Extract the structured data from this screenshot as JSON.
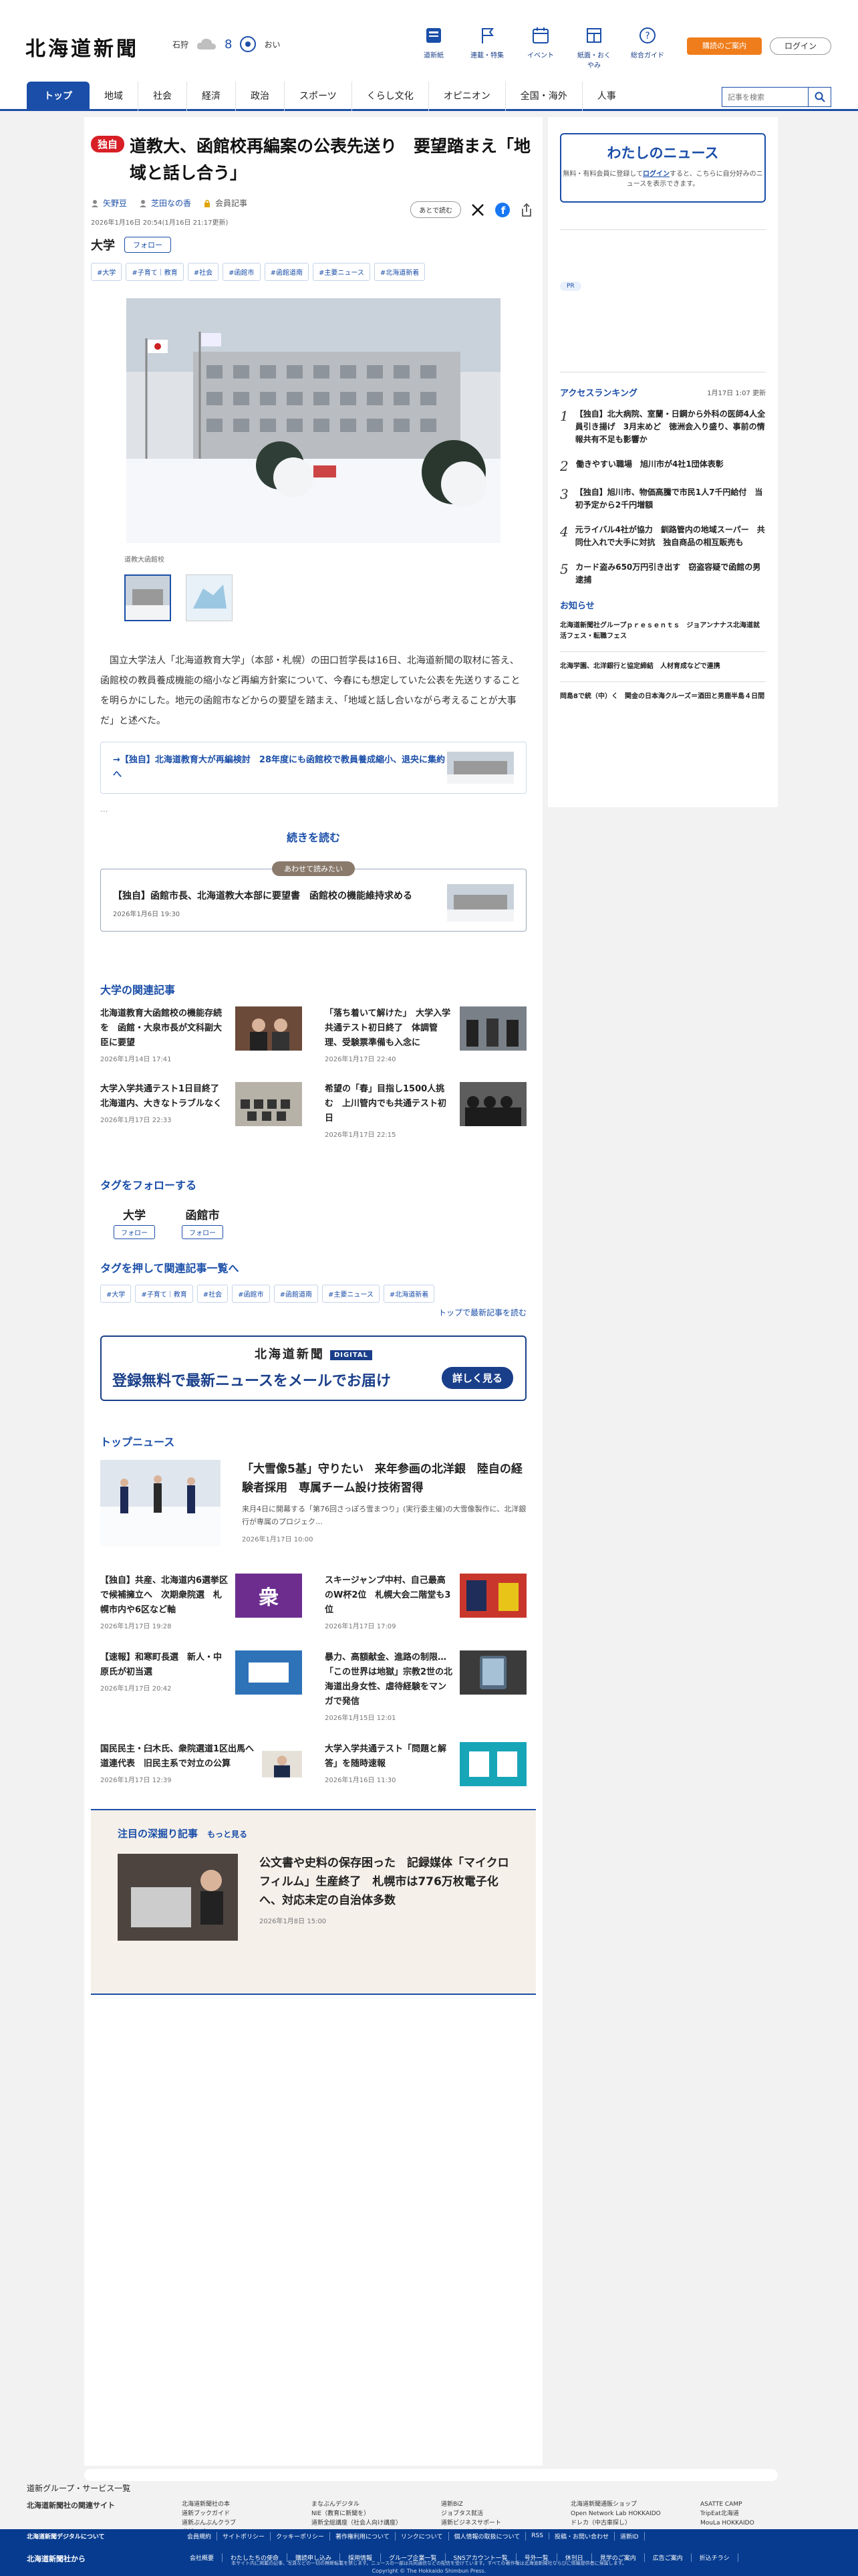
{
  "header": {
    "logo": "北海道新聞",
    "weather": {
      "city": "石狩",
      "temp": "8",
      "sub": "おい"
    },
    "nav": [
      "道新紙",
      "連載・特集",
      "イベント",
      "紙面・おくやみ",
      "総合ガイド"
    ],
    "exclusive_btn": "購読のご案内",
    "login_btn": "ログイン"
  },
  "gnav": {
    "tabs": [
      "トップ",
      "地域",
      "社会",
      "経済",
      "政治",
      "スポーツ",
      "くらし文化",
      "オピニオン",
      "全国・海外",
      "人事"
    ],
    "search_placeholder": "記事を検索"
  },
  "article": {
    "badge": "独自",
    "title": "道教大、函館校再編案の公表先送り　要望踏まえ「地域と話し合う」",
    "authors": [
      "矢野豆",
      "芝田なの香"
    ],
    "author_extra": "会員記事",
    "dates": "2026年1月16日 20:54(1月16日 21:17更新)",
    "later": "あとで読む",
    "category": "大学",
    "follow": "フォロー",
    "tags": [
      "#大学",
      "#子育て｜教育",
      "#社会",
      "#函館市",
      "#函館道南",
      "#主要ニュース",
      "#北海道新着"
    ],
    "caption": "道教大函館校",
    "body": "　国立大学法人「北海道教育大学」（本部・札幌）の田口哲学長は16日、北海道新聞の取材に答え、函館校の教員養成機能の縮小など再編方針案について、今春にも想定していた公表を先送りすることを明らかにした。地元の函館市などからの要望を踏まえ、「地域と話し合いながら考えることが大事だ」と述べた。",
    "related": "→【独自】北海道教育大が再編検討　28年度にも函館校で教員養成縮小、退央に集約へ",
    "fade": "...",
    "readmore": "続きを読む",
    "also_label": "あわせて読みたい",
    "also_title": "【独自】函館市長、北海道教大本部に要望書　函館校の機能維持求める",
    "also_date": "2026年1月6日 19:30"
  },
  "related_section": {
    "title": "大学の関連記事",
    "items": [
      {
        "title": "北海道教育大函館校の機能存続を　函館・大泉市長が文科副大臣に要望",
        "date": "2026年1月14日 17:41"
      },
      {
        "title": "「落ち着いて解けた」　大学入学共通テスト初日終了　体調管理、受験票準備も入念に",
        "date": "2026年1月17日 22:40"
      },
      {
        "title": "大学入学共通テスト1日目終了　北海道内、大きなトラブルなく",
        "date": "2026年1月17日 22:33"
      },
      {
        "title": "希望の「春」目指し1500人挑む　上川管内でも共通テスト初日",
        "date": "2026年1月17日 22:15"
      }
    ]
  },
  "follow_section": {
    "title": "タグをフォローする",
    "tags": [
      "大学",
      "函館市"
    ],
    "btn": "フォロー"
  },
  "tag_section": {
    "title": "タグを押して関連記事一覧へ",
    "tags": [
      "#大学",
      "#子育て｜教育",
      "#社会",
      "#函館市",
      "#函館道南",
      "#主要ニュース",
      "#北海道新着"
    ],
    "to_new": "トップで最新記事を読む"
  },
  "digital": {
    "logo": "北海道新聞",
    "badge": "DIGITAL",
    "msg": "登録無料で最新ニュースをメールでお届け",
    "btn": "詳しく見る"
  },
  "top_news": {
    "title": "トップニュース",
    "main": {
      "title": "「大雪像5基」守りたい　来年参画の北洋銀　陸自の経験者採用　専属チーム設け技術習得",
      "text": "来月4日に開幕する「第76回さっぽろ雪まつり」(実行委主催)の大雪像製作に、北洋銀行が専属のプロジェク…",
      "date": "2026年1月17日 10:00"
    },
    "items": [
      {
        "title": "【独自】共産、北海道内6選挙区で候補擁立へ　次期衆院選　札幌市内や6区など軸",
        "date": "2026年1月17日 19:28"
      },
      {
        "title": "スキージャンプ中村、自己最高のW杯2位　札幌大会二階堂も3位",
        "date": "2026年1月17日 17:09"
      },
      {
        "title": "【速報】和寒町長選　新人・中原氏が初当選",
        "date": "2026年1月17日 20:42"
      },
      {
        "title": "暴力、高額献金、進路の制限…「この世界は地獄」宗教2世の北海道出身女性、虐待経験をマンガで発信",
        "date": "2026年1月15日 12:01"
      },
      {
        "title": "国民民主・臼木氏、衆院選道1区出馬へ　道連代表　旧民主系で対立の公算",
        "date": "2026年1月17日 12:39"
      },
      {
        "title": "大学入学共通テスト「問題と解答」を随時速報",
        "date": "2026年1月16日 11:30"
      }
    ]
  },
  "deep": {
    "title": "注目の深掘り記事",
    "more": "もっと見る",
    "item_title": "公文書や史料の保存困った　記録媒体「マイクロフィルム」生産終了　札幌市は776万枚電子化へ、対応未定の自治体多数",
    "item_date": "2026年1月8日 15:00"
  },
  "side": {
    "my_news_title": "わたしのニュース",
    "my_news_text1": "無料・有料会員に登録して",
    "my_news_login": "ログイン",
    "my_news_text2": "すると、こちらに自分好みのニュースを表示できます。",
    "pr": "PR",
    "ranking_title": "アクセスランキング",
    "ranking_date": "1月17日 1:07 更新",
    "ranking": [
      "【独自】北大病院、室蘭・日鋼から外科の医師4人全員引き揚げ　3月末めど　徳洲会入り盛り、事前の情報共有不足も影響か",
      "働きやすい職場　旭川市が4社1団体表彰",
      "【独自】旭川市、物価高騰で市民1人7千円給付　当初予定から2千円増額",
      "元ライバル4社が協力　釧路管内の地域スーパー　共同仕入れで大手に対抗　独自商品の相互販売も",
      "カード盗み650万円引き出す　窃盗容疑で函館の男逮捕"
    ],
    "notice_title": "お知らせ",
    "notices": [
      "北海道新聞社グループｐｒｅｓｅｎｔｓ　ジョアンナナス北海道就活フェス・転職フェス",
      "北海学園、北洋銀行と協定締結　人材育成などで連携",
      "岡島8で統（中）く　関金の日本海クルーズ＝酒田と男鹿半島４日間"
    ]
  },
  "footer": {
    "group": "道新グループ・サービス一覧",
    "sites_title": "北海道新聞社の関連サイト",
    "cols": [
      [
        "北海道新聞社の本",
        "道新ブックガイド",
        "道新ぶんぶんクラブ",
        "道新スポーツ"
      ],
      [
        "まなぶんデジタル",
        "NIE（教育に新聞を）",
        "道新全総講座（社会人向け講座）"
      ],
      [
        "道新BiZ",
        "ジョブタス就活",
        "道新ビジネスサポート",
        "ジョアンナナス北海道"
      ],
      [
        "北海道新聞通販ショップ",
        "Open Network Lab HOKKAIDO",
        "ドレカ（中古車探し）"
      ],
      [
        "ASATTE CAMP",
        "TripEat北海道",
        "MouLa HOKKAIDO"
      ]
    ],
    "blue_row1_title": "北海道新聞社から",
    "blue_row1": [
      "会社概要",
      "わたしたちの使命",
      "購読申し込み",
      "採用情報",
      "グループ企業一覧",
      "SNSアカウント一覧",
      "号外一覧",
      "休刊日",
      "見学のご案内",
      "広告ご案内",
      "折込チラシ"
    ],
    "blue_row2_title": "北海道新聞デジタルについて",
    "blue_row2": [
      "会員規約",
      "サイトポリシー",
      "クッキーポリシー",
      "著作権利用について",
      "リンクについて",
      "個人情報の取扱について",
      "RSS",
      "投稿・お問い合わせ",
      "道新ID"
    ],
    "disclaimer": "本サイト内に掲載の記事、写真などの一切の無断転載を禁じます。ニュースの一部は共同通信などの配信を受けています。すべての著作権は北海道新聞社ならびに情報提供者に帰属します。",
    "copyright": "Copyright © The Hokkaido Shimbun Press."
  }
}
